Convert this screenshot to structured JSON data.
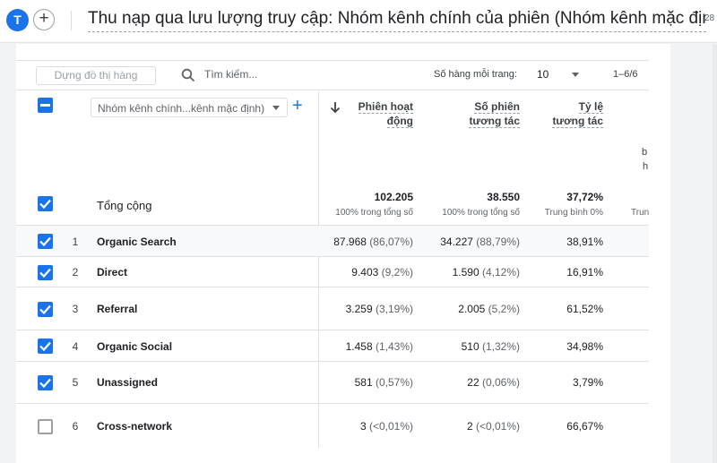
{
  "header": {
    "avatar_letter": "T",
    "add_label": "+",
    "title": "Thu nạp qua lưu lượng truy cập: Nhóm kênh chính của phiên (Nhóm kênh mặc định)",
    "date_fragment": "28"
  },
  "toolbar": {
    "plot_rows_button": "Dựng đồ thị hàng",
    "search_placeholder": "Tìm kiếm...",
    "rows_per_page_label": "Số hàng mỗi trang:",
    "rows_per_page_value": "10",
    "pagination": "1–6/6"
  },
  "table": {
    "dimension_selector": "Nhóm kênh chính...kênh mặc định)",
    "add_dimension": "+",
    "columns": [
      {
        "line1": "Phiên hoạt",
        "line2": "động"
      },
      {
        "line1": "Số phiên",
        "line2": "tương tác"
      },
      {
        "line1": "Tỷ lệ",
        "line2": "tương tác"
      }
    ],
    "partial_column_fragments": [
      "b",
      "h"
    ],
    "partial_total_fragment": "Trun",
    "totals": {
      "label": "Tổng cộng",
      "values": [
        "102.205",
        "38.550",
        "37,72%"
      ],
      "subs": [
        "100% trong tổng số",
        "100% trong tổng số",
        "Trung bình 0%"
      ]
    },
    "rows": [
      {
        "index": "1",
        "name": "Organic Search",
        "sessions": "87.968",
        "sessions_pct": "(86,07%)",
        "engaged": "34.227",
        "engaged_pct": "(88,79%)",
        "rate": "38,91%",
        "checked": true
      },
      {
        "index": "2",
        "name": "Direct",
        "sessions": "9.403",
        "sessions_pct": "(9,2%)",
        "engaged": "1.590",
        "engaged_pct": "(4,12%)",
        "rate": "16,91%",
        "checked": true
      },
      {
        "index": "3",
        "name": "Referral",
        "sessions": "3.259",
        "sessions_pct": "(3,19%)",
        "engaged": "2.005",
        "engaged_pct": "(5,2%)",
        "rate": "61,52%",
        "checked": true
      },
      {
        "index": "4",
        "name": "Organic Social",
        "sessions": "1.458",
        "sessions_pct": "(1,43%)",
        "engaged": "510",
        "engaged_pct": "(1,32%)",
        "rate": "34,98%",
        "checked": true
      },
      {
        "index": "5",
        "name": "Unassigned",
        "sessions": "581",
        "sessions_pct": "(0,57%)",
        "engaged": "22",
        "engaged_pct": "(0,06%)",
        "rate": "3,79%",
        "checked": true
      },
      {
        "index": "6",
        "name": "Cross-network",
        "sessions": "3",
        "sessions_pct": "(<0,01%)",
        "engaged": "2",
        "engaged_pct": "(<0,01%)",
        "rate": "66,67%",
        "checked": false
      }
    ]
  },
  "colors": {
    "accent": "#1a73e8",
    "divider": "#e0e0e0"
  }
}
